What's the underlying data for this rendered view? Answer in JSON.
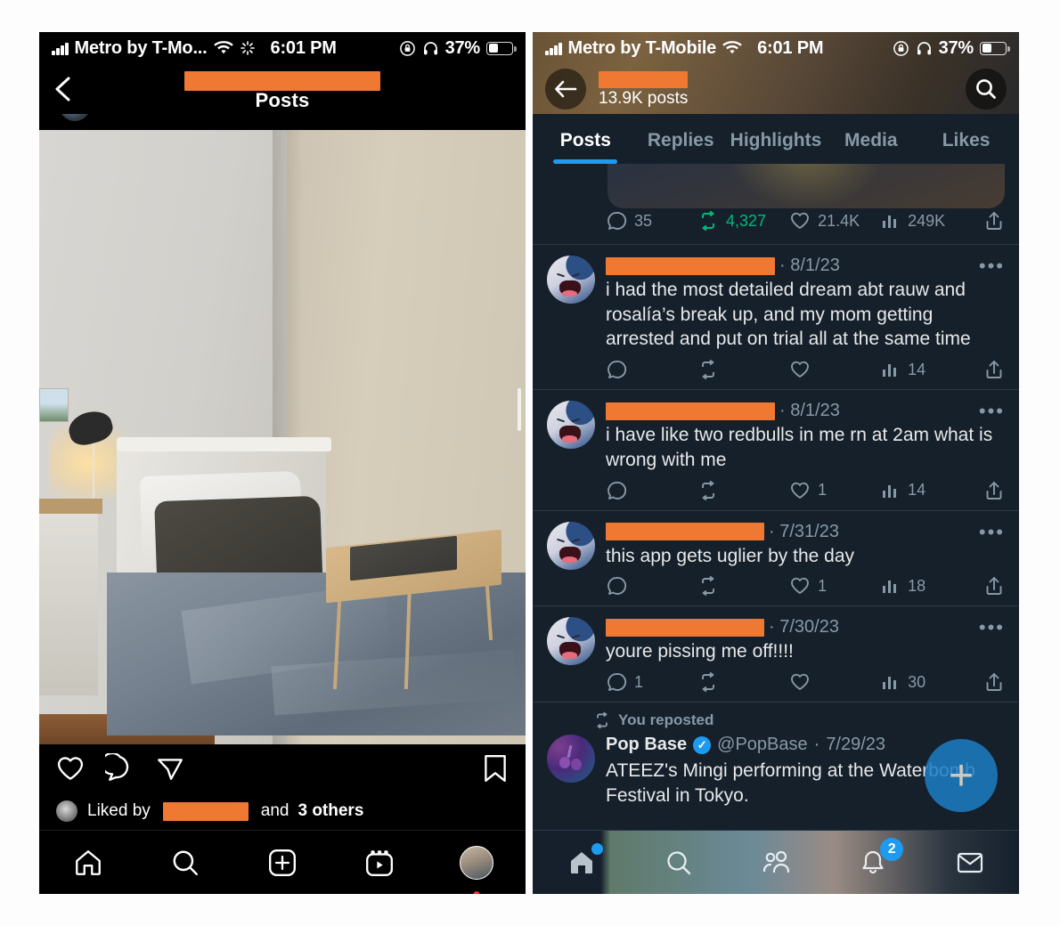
{
  "instagram": {
    "status_bar": {
      "carrier": "Metro by T-Mo...",
      "time": "6:01 PM",
      "battery_percent": "37%",
      "wifi_icon": "wifi-icon",
      "sync_icon": "sync-spinner-icon",
      "rotation_lock_icon": "rotation-lock-icon",
      "headphones_icon": "headphones-icon",
      "battery_icon": "battery-icon"
    },
    "nav": {
      "back_icon": "chevron-left-icon",
      "username_redacted": true,
      "title": "Posts"
    },
    "post": {
      "image_alt": "bedroom with white bed frame, dark pillow, blue bedding and a wooden lap desk with a laptop",
      "like_icon": "heart-icon",
      "comment_icon": "comment-bubble-icon",
      "share_icon": "paper-plane-icon",
      "save_icon": "bookmark-icon",
      "liked_by_prefix": "Liked by",
      "liked_by_redacted": true,
      "liked_by_middle": "and",
      "liked_by_count": "3 others"
    },
    "tabbar": {
      "items": [
        {
          "name": "home-icon",
          "label": "Home"
        },
        {
          "name": "search-icon",
          "label": "Search"
        },
        {
          "name": "create-icon",
          "label": "Create"
        },
        {
          "name": "reels-icon",
          "label": "Reels"
        },
        {
          "name": "profile-avatar",
          "label": "Profile"
        }
      ]
    }
  },
  "twitter": {
    "status_bar": {
      "carrier": "Metro by T-Mobile",
      "time": "6:01 PM",
      "battery_percent": "37%",
      "wifi_icon": "wifi-icon",
      "rotation_lock_icon": "rotation-lock-icon",
      "headphones_icon": "headphones-icon",
      "battery_icon": "battery-icon"
    },
    "header": {
      "back_icon": "arrow-left-icon",
      "name_redacted": true,
      "post_count": "13.9K posts",
      "search_icon": "search-icon"
    },
    "tabs": [
      {
        "label": "Posts",
        "active": true
      },
      {
        "label": "Replies",
        "active": false
      },
      {
        "label": "Highlights",
        "active": false
      },
      {
        "label": "Media",
        "active": false
      },
      {
        "label": "Likes",
        "active": false
      }
    ],
    "partial_tweet_metrics": {
      "replies": "35",
      "reposts": "4,327",
      "likes": "21.4K",
      "views": "249K",
      "reposts_highlighted": true
    },
    "tweets": [
      {
        "name_redacted": true,
        "date": "8/1/23",
        "text": "i had the most detailed dream abt rauw and rosalía’s break up, and my mom getting arrested and put on trial all at the same time",
        "replies": "",
        "reposts": "",
        "likes": "",
        "views": "14"
      },
      {
        "name_redacted": true,
        "date": "8/1/23",
        "text": "i have like two redbulls in me rn at 2am what is wrong with me",
        "replies": "",
        "reposts": "",
        "likes": "1",
        "views": "14"
      },
      {
        "name_redacted": true,
        "date": "7/31/23",
        "text": "this app gets uglier by the day",
        "replies": "",
        "reposts": "",
        "likes": "1",
        "views": "18"
      },
      {
        "name_redacted": true,
        "date": "7/30/23",
        "text": "youre pissing me off!!!!",
        "replies": "1",
        "reposts": "",
        "likes": "",
        "views": "30"
      }
    ],
    "repost": {
      "repost_icon": "repost-icon",
      "repost_label": "You reposted",
      "author_name": "Pop Base",
      "verified": true,
      "handle": "@PopBase",
      "date_separator": "·",
      "date": "7/29/23",
      "text": "ATEEZ's Mingi performing at the Waterbomb Festival in Tokyo."
    },
    "compose": {
      "icon": "plus-icon",
      "label": "Compose post"
    },
    "tabbar": {
      "items": [
        {
          "name": "home-icon",
          "label": "Home",
          "dot": true,
          "badge": ""
        },
        {
          "name": "search-icon",
          "label": "Search",
          "dot": false,
          "badge": ""
        },
        {
          "name": "communities-icon",
          "label": "Communities",
          "dot": false,
          "badge": ""
        },
        {
          "name": "notifications-bell-icon",
          "label": "Notifications",
          "dot": false,
          "badge": "2"
        },
        {
          "name": "messages-envelope-icon",
          "label": "Messages",
          "dot": false,
          "badge": ""
        }
      ]
    }
  },
  "colors": {
    "redaction": "#ef7833",
    "twitter_bg": "#15202b",
    "twitter_accent": "#1d9bf0",
    "repost_green": "#00ba7c",
    "muted_text": "#8899a6",
    "instagram_bg": "#000000"
  }
}
